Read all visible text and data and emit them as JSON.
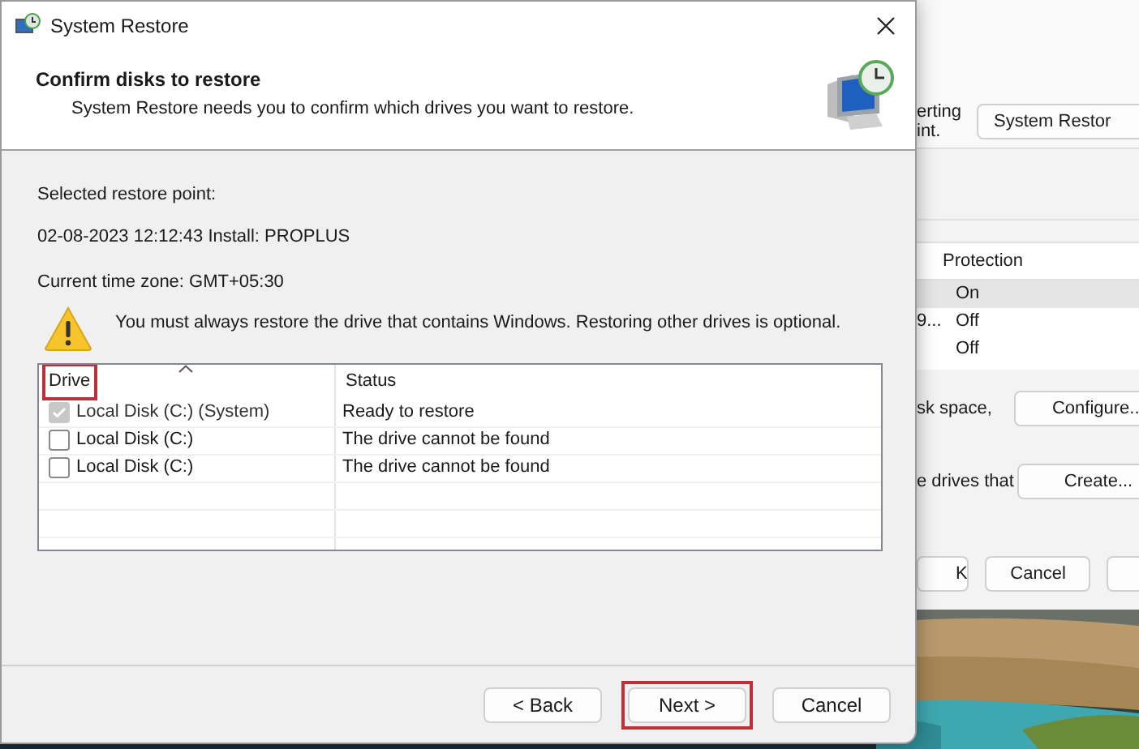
{
  "background_window": {
    "fragments": [
      "erting",
      "int."
    ],
    "restore_button": "System Restor",
    "table": {
      "column": "Protection",
      "cut_value": "9...",
      "rows": [
        {
          "value": "On",
          "selected": true
        },
        {
          "value": "Off",
          "selected": false
        },
        {
          "value": "Off",
          "selected": false
        }
      ]
    },
    "disk_space_text": "sk space,",
    "configure_button": "Configure..",
    "drives_text": "e drives that",
    "create_button": "Create...",
    "buttons": [
      "K",
      "Cancel"
    ]
  },
  "dialog": {
    "title": "System Restore",
    "heading": "Confirm disks to restore",
    "subheading": "System Restore needs you to confirm which drives you want to restore.",
    "restore_point_label": "Selected restore point:",
    "restore_point": "02-08-2023 12:12:43 Install: PROPLUS",
    "time_zone": "Current time zone: GMT+05:30",
    "warning": "You must always restore the drive that contains Windows. Restoring other drives is optional.",
    "table": {
      "columns": [
        {
          "label": "Drive",
          "highlighted": true,
          "sorted": true
        },
        {
          "label": "Status",
          "highlighted": false,
          "sorted": false
        }
      ],
      "rows": [
        {
          "drive": "Local Disk (C:) (System)",
          "status": "Ready to restore",
          "checked": true,
          "disabled": true
        },
        {
          "drive": "Local Disk (C:)",
          "status": "The drive cannot be found",
          "checked": false,
          "disabled": false
        },
        {
          "drive": "Local Disk (C:)",
          "status": "The drive cannot be found",
          "checked": false,
          "disabled": false
        }
      ]
    },
    "buttons": [
      {
        "label": "< Back",
        "highlighted": false
      },
      {
        "label": "Next >",
        "highlighted": true
      },
      {
        "label": "Cancel",
        "highlighted": false
      }
    ]
  }
}
